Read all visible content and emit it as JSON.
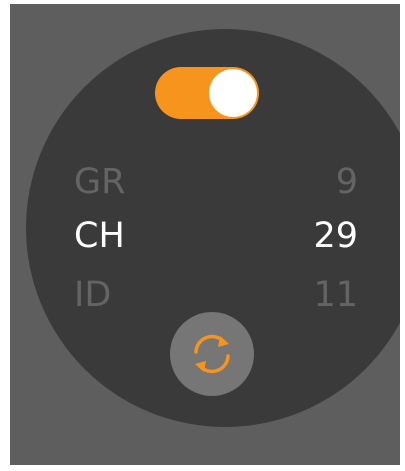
{
  "toggle": {
    "state": "on",
    "accent": "#f7941d"
  },
  "list": {
    "items": [
      {
        "code": "GR",
        "count": "9",
        "state": "dim"
      },
      {
        "code": "CH",
        "count": "29",
        "state": "active"
      },
      {
        "code": "ID",
        "count": "11",
        "state": "dim"
      }
    ]
  },
  "refresh": {
    "icon": "refresh-icon"
  },
  "colors": {
    "background": "#5e5e5e",
    "dial": "#3a3a3a",
    "accent": "#f7941d",
    "text_active": "#ffffff",
    "text_dim": "#646464"
  }
}
